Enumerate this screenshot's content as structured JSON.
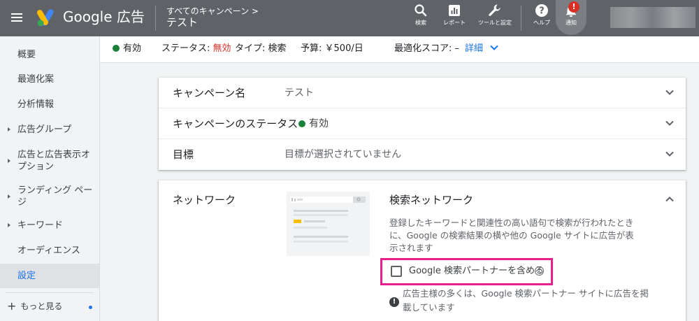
{
  "header": {
    "brand": "Google 広告",
    "breadcrumb_parent": "すべてのキャンペーン",
    "breadcrumb_arrow": ">",
    "campaign_title": "テスト",
    "tools": [
      {
        "label": "検索",
        "icon": "search-icon"
      },
      {
        "label": "レポート",
        "icon": "report-icon"
      },
      {
        "label": "ツールと設定",
        "icon": "wrench-icon"
      },
      {
        "label": "ヘルプ",
        "icon": "help-icon"
      },
      {
        "label": "通知",
        "icon": "bell-icon"
      }
    ],
    "notification_badge": "!"
  },
  "sidebar": {
    "items": [
      {
        "label": "概要",
        "expandable": false,
        "active": false
      },
      {
        "label": "最適化案",
        "expandable": false,
        "active": false
      },
      {
        "label": "分析情報",
        "expandable": false,
        "active": false
      },
      {
        "label": "広告グループ",
        "expandable": true,
        "active": false
      },
      {
        "label": "広告と広告表示オプション",
        "expandable": true,
        "active": false
      },
      {
        "label": "ランディング ページ",
        "expandable": true,
        "active": false
      },
      {
        "label": "キーワード",
        "expandable": true,
        "active": false
      },
      {
        "label": "オーディエンス",
        "expandable": false,
        "active": false
      },
      {
        "label": "設定",
        "expandable": false,
        "active": true
      }
    ],
    "more_label": "もっと見る"
  },
  "status": {
    "enabled": "有効",
    "status_label": "ステータス:",
    "status_value": "無効",
    "type_label": "タイプ:",
    "type_value": "検索",
    "budget_label": "予算:",
    "budget_value": "￥500/日",
    "score_label": "最適化スコア:",
    "score_value": "–",
    "details_link": "詳細"
  },
  "settings": {
    "rows": [
      {
        "label": "キャンペーン名",
        "value": "テスト"
      },
      {
        "label": "キャンペーンのステータス",
        "value": "有効"
      },
      {
        "label": "目標",
        "value": "目標が選択されていません"
      }
    ],
    "network": {
      "label": "ネットワーク",
      "title": "検索ネットワーク",
      "description": "登録したキーワードと関連性の高い語句で検索が行われたときに、Google の検索結果の横や他の Google サイトに広告が表示されます",
      "checkbox_label": "Google 検索パートナーを含める",
      "checkbox_checked": false,
      "note": "広告主様の多くは、Google 検索パートナー サイトに広告を掲載しています"
    }
  },
  "colors": {
    "topbar": "#5f6368",
    "accent": "#1a73e8",
    "status_green": "#188038",
    "status_red": "#d93025",
    "highlight": "#e7208d"
  }
}
